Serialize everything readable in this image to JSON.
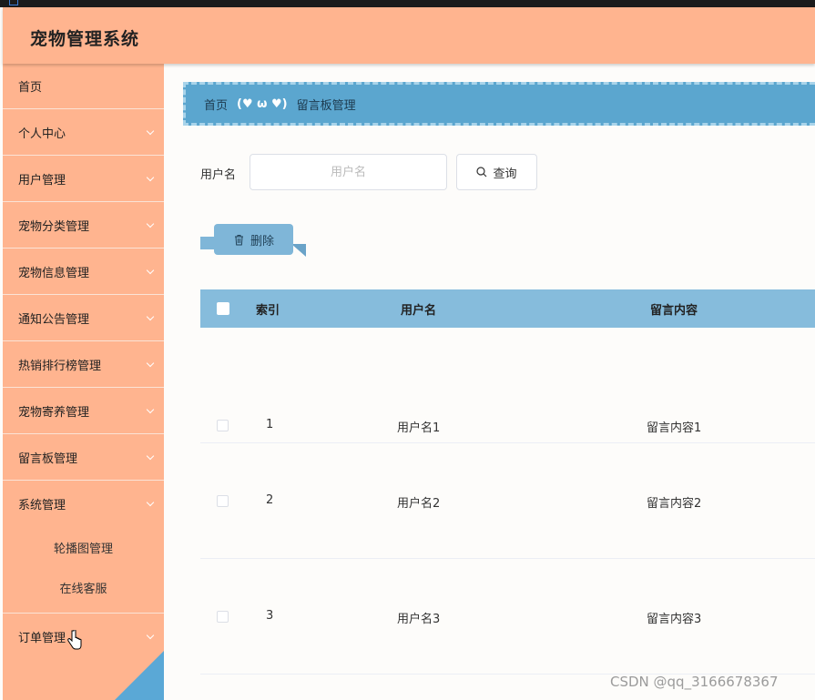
{
  "app": {
    "title": "宠物管理系统"
  },
  "sidebar": {
    "items": [
      {
        "label": "首页",
        "has_children": false
      },
      {
        "label": "个人中心",
        "has_children": true
      },
      {
        "label": "用户管理",
        "has_children": true
      },
      {
        "label": "宠物分类管理",
        "has_children": true
      },
      {
        "label": "宠物信息管理",
        "has_children": true
      },
      {
        "label": "通知公告管理",
        "has_children": true
      },
      {
        "label": "热销排行榜管理",
        "has_children": true
      },
      {
        "label": "宠物寄养管理",
        "has_children": true
      },
      {
        "label": "留言板管理",
        "has_children": true
      },
      {
        "label": "系统管理",
        "has_children": true,
        "expanded": true,
        "children": [
          {
            "label": "轮播图管理"
          },
          {
            "label": "在线客服"
          }
        ]
      },
      {
        "label": "订单管理",
        "has_children": true
      }
    ]
  },
  "breadcrumb": {
    "home": "首页",
    "separator": "(♥ ω ♥)",
    "current": "留言板管理"
  },
  "search": {
    "label": "用户名",
    "placeholder": "用户名",
    "value": "",
    "button_label": "查询"
  },
  "actions": {
    "delete_label": "删除"
  },
  "table": {
    "columns": [
      "索引",
      "用户名",
      "留言内容"
    ],
    "rows": [
      {
        "index": "1",
        "username": "用户名1",
        "content": "留言内容1"
      },
      {
        "index": "2",
        "username": "用户名2",
        "content": "留言内容2"
      },
      {
        "index": "3",
        "username": "用户名3",
        "content": "留言内容3"
      }
    ]
  },
  "watermark": "CSDN @qq_3166678367",
  "colors": {
    "header": "#ffb48f",
    "sidebar": "#ffb48f",
    "breadcrumb": "#5ba6cf",
    "table_header": "#86bcdc",
    "delete_button": "#7fb6d8"
  },
  "icons": {
    "search": "search-icon",
    "delete": "trash-icon",
    "submenu": "chevron-down-icon"
  }
}
